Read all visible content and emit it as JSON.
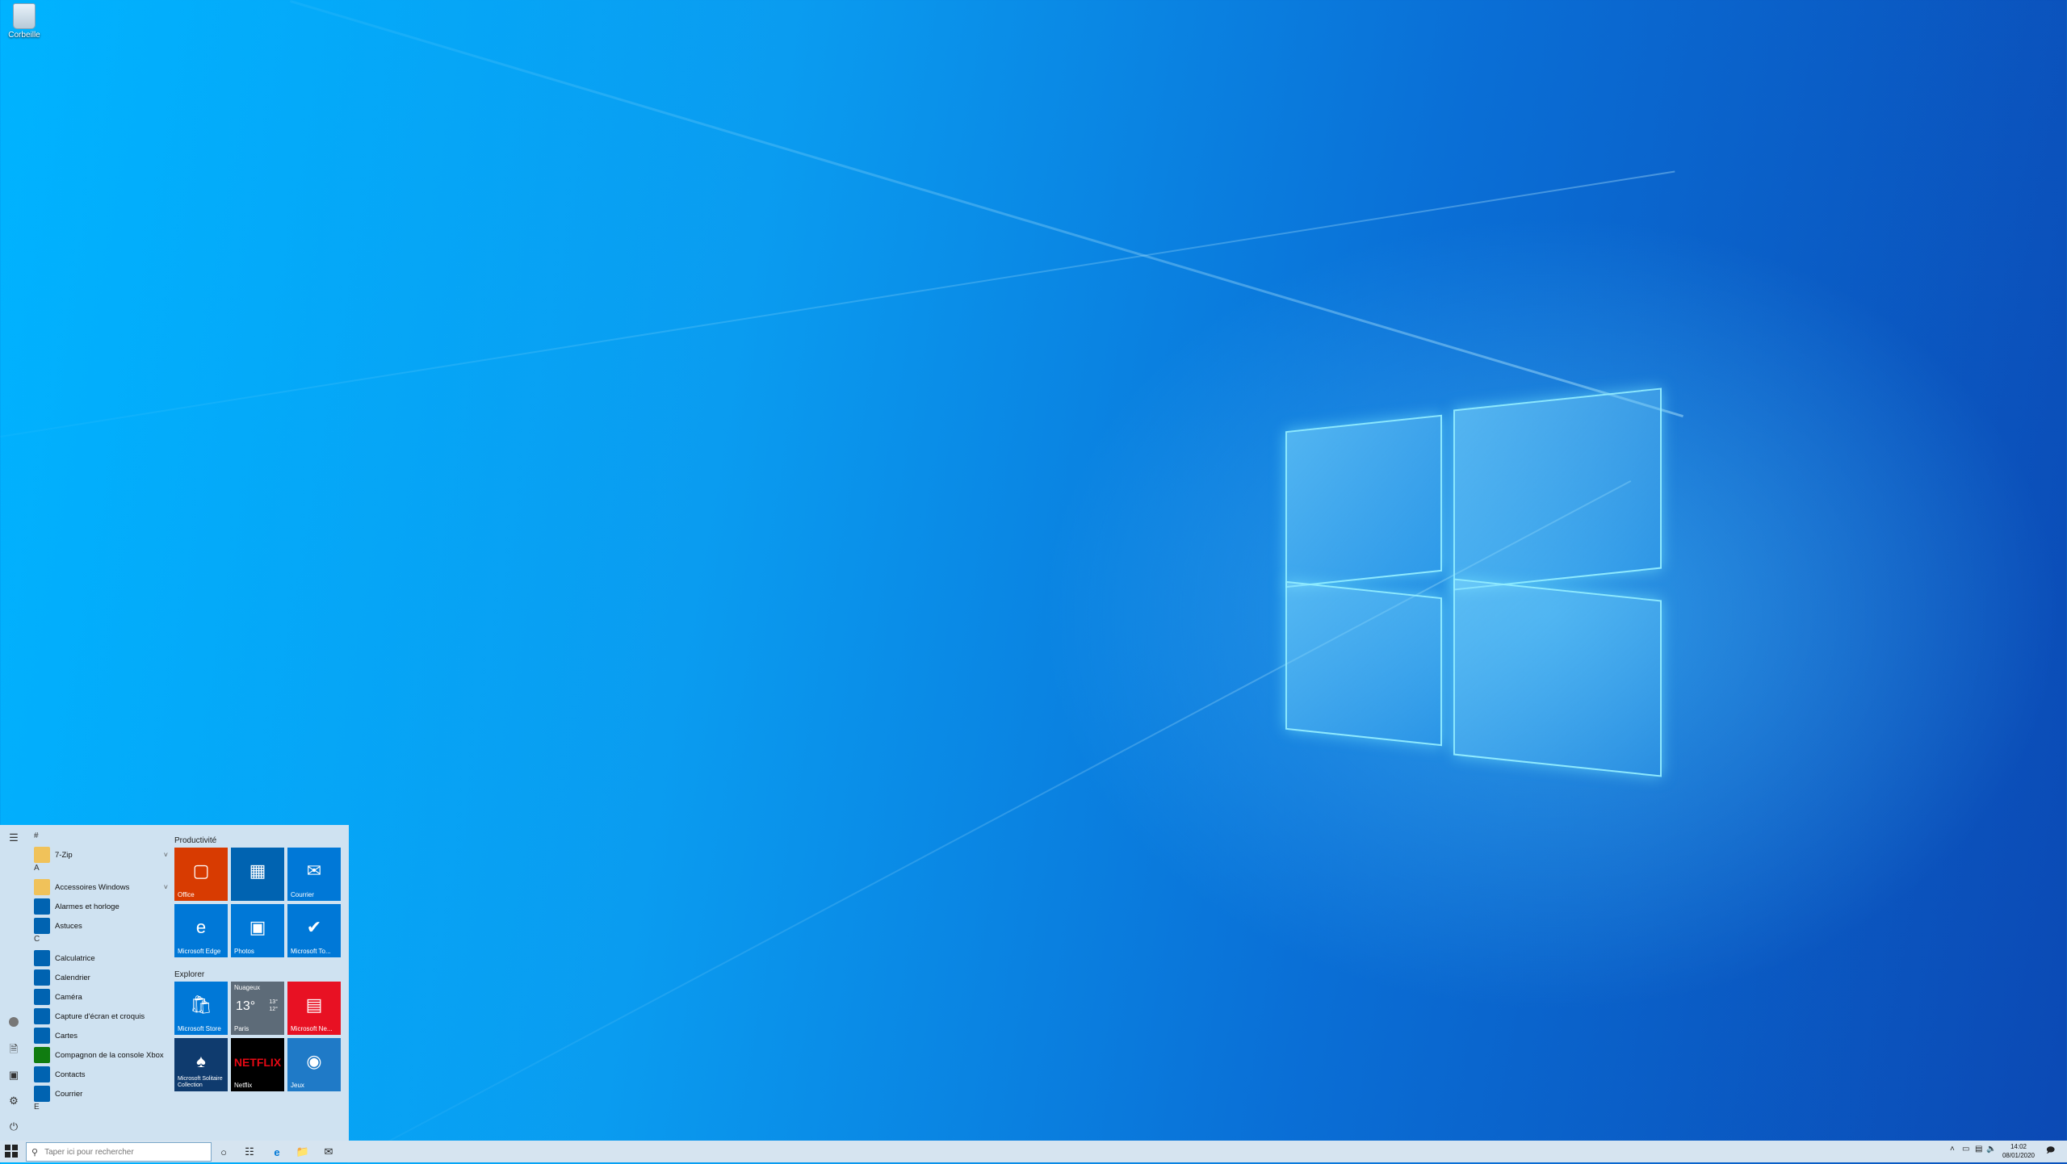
{
  "desktop": {
    "recycle_bin_label": "Corbeille"
  },
  "start_menu": {
    "app_list": [
      {
        "type": "header",
        "label": "#"
      },
      {
        "type": "app",
        "label": "7-Zip",
        "icon": "folder-icon",
        "color": "#f0c25a",
        "expandable": true
      },
      {
        "type": "header",
        "label": "A"
      },
      {
        "type": "app",
        "label": "Accessoires Windows",
        "icon": "folder-icon",
        "color": "#f0c25a",
        "expandable": true
      },
      {
        "type": "app",
        "label": "Alarmes et horloge",
        "icon": "clock-icon",
        "color": "#0063b1"
      },
      {
        "type": "app",
        "label": "Astuces",
        "icon": "lightbulb-icon",
        "color": "#0063b1"
      },
      {
        "type": "header",
        "label": "C"
      },
      {
        "type": "app",
        "label": "Calculatrice",
        "icon": "calculator-icon",
        "color": "#0063b1"
      },
      {
        "type": "app",
        "label": "Calendrier",
        "icon": "calendar-icon",
        "color": "#0063b1"
      },
      {
        "type": "app",
        "label": "Caméra",
        "icon": "camera-icon",
        "color": "#0063b1"
      },
      {
        "type": "app",
        "label": "Capture d'écran et croquis",
        "icon": "snip-icon",
        "color": "#0063b1"
      },
      {
        "type": "app",
        "label": "Cartes",
        "icon": "map-pin-icon",
        "color": "#0063b1"
      },
      {
        "type": "app",
        "label": "Compagnon de la console Xbox",
        "icon": "xbox-icon",
        "color": "#107c10"
      },
      {
        "type": "app",
        "label": "Contacts",
        "icon": "people-icon",
        "color": "#0063b1"
      },
      {
        "type": "app",
        "label": "Courrier",
        "icon": "mail-icon",
        "color": "#0063b1"
      },
      {
        "type": "header",
        "label": "E"
      }
    ],
    "groups": [
      {
        "title": "Productivité",
        "tiles": [
          {
            "label": "Office",
            "color": "#d83b01",
            "icon": "office-icon"
          },
          {
            "label": "",
            "color": "#0063b1",
            "icon": "office-apps-icon"
          },
          {
            "label": "Courrier",
            "color": "#0078d7",
            "icon": "mail-icon"
          },
          {
            "label": "Microsoft Edge",
            "color": "#0078d7",
            "icon": "edge-icon"
          },
          {
            "label": "Photos",
            "color": "#0078d7",
            "icon": "photos-icon"
          },
          {
            "label": "Microsoft To...",
            "color": "#0078d7",
            "icon": "checkmark-icon"
          }
        ]
      },
      {
        "title": "Explorer",
        "tiles": [
          {
            "label": "Microsoft Store",
            "color": "#0078d7",
            "icon": "store-icon"
          },
          {
            "label": "Paris",
            "color": "#5d6b78",
            "icon": "weather-icon",
            "condition": "Nuageux",
            "temp": "13°",
            "high": "13°",
            "low": "12°"
          },
          {
            "label": "Microsoft Ne...",
            "color": "#e81123",
            "icon": "news-icon"
          },
          {
            "label": "Microsoft Solitaire Collection",
            "color": "#0f3b6e",
            "icon": "cards-icon"
          },
          {
            "label": "Netflix",
            "color": "#000000",
            "icon": "netflix-logo-icon",
            "brand": "NETFLIX"
          },
          {
            "label": "Jeux",
            "color": "#1f7ac7",
            "icon": "games-icon"
          }
        ]
      }
    ]
  },
  "taskbar": {
    "search_placeholder": "Taper ici pour rechercher",
    "time": "14:02",
    "date": "08/01/2020"
  }
}
